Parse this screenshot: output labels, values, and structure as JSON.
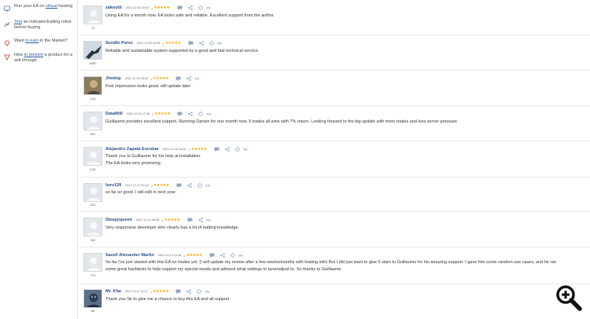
{
  "sidebar": {
    "items": [
      {
        "prefix": "Run your EA on ",
        "link": "virtual",
        "suffix": " hosting",
        "icon": "vps-icon"
      },
      {
        "prefix": "",
        "link": "Test",
        "suffix": " an indicator/trading robot before buying",
        "icon": "test-icon"
      },
      {
        "prefix": "Want ",
        "link": "to earn",
        "suffix": " in the Market?",
        "icon": "money-icon"
      },
      {
        "prefix": "How ",
        "link": "to present",
        "suffix": " a product for a sell-through",
        "icon": "present-icon"
      }
    ]
  },
  "reviews": [
    {
      "name": "zakoutit",
      "date": "2021.12.30 02:40",
      "stars": "★★★★★",
      "count": "74",
      "avatar": "default",
      "tr": "TR",
      "lines": [
        "Using EA for a month now. EA looks safe and reliable. Excellent support from the author."
      ]
    },
    {
      "name": "Serafin Perez",
      "date": "2021.12.29 16:36",
      "stars": "★★★★★",
      "count": "3400",
      "avatar": "bird",
      "tr": "TR",
      "lines": [
        "Reliable and sustainable system supported by a good and fast technical service."
      ]
    },
    {
      "name": "Jimdog",
      "date": "2021.12.29 16:30",
      "stars": "★★★★★",
      "count": "124",
      "avatar": "person",
      "tr": "TR",
      "lines": [
        "First impression looks good. will update later"
      ]
    },
    {
      "name": "DataWill",
      "date": "2021.12.29 17:35",
      "stars": "★★★★★",
      "count": "391",
      "avatar": "default",
      "tr": "TR",
      "lines": [
        "Guillaume provides excellent support. Running Darwin for one month now, 5 trades all wins with 7% return. Looking forward to the big update with more trades and less server pressure."
      ]
    },
    {
      "name": "Alejandro Zapata Escobar",
      "date": "2021.12.28 15:34",
      "stars": "★★★★★",
      "count": "149",
      "avatar": "default",
      "tr": "TR",
      "lines": [
        "Thank you to Guillaume for his help at installation.",
        "The EA looks very promising."
      ]
    },
    {
      "name": "loev139",
      "date": "2021.12.17 00:16",
      "stars": "★★★★★",
      "count": "331",
      "avatar": "default",
      "tr": "TR",
      "lines": [
        "so far so good. I will edit in next year."
      ]
    },
    {
      "name": "Sleepyqueen",
      "date": "2021.12.14 08:55",
      "stars": "★★★★★",
      "count": "182",
      "avatar": "default",
      "tr": "TR",
      "lines": [
        "Very responsive developer who clearly has a lot of trading knowledge."
      ]
    },
    {
      "name": "Savell Alexander Martin",
      "date": "2021.12.13 12:18",
      "stars": "★★★★★",
      "count": "779",
      "avatar": "default",
      "tr": "TR",
      "lines": [
        "So far I've just started with this EA no trades yet. (I will update my review after a few weeks/months with trading info) But I did just want to give 5 stars to Guillaume for his amazing support. I gave him some random use cases, and he ran",
        "some great backtests to help support my special needs and advised what settings to tune/adjust to. So thanks to Guillaume"
      ]
    },
    {
      "name": "Mr. Kha",
      "date": "2021.12.11 22:17",
      "stars": "★★★★★",
      "count": "68",
      "avatar": "face",
      "tr": "TR",
      "lines": [
        "Thank you Sir to give me a chance to buy this EA and all support."
      ]
    }
  ],
  "zoom": {
    "icon": "zoom-icon"
  }
}
